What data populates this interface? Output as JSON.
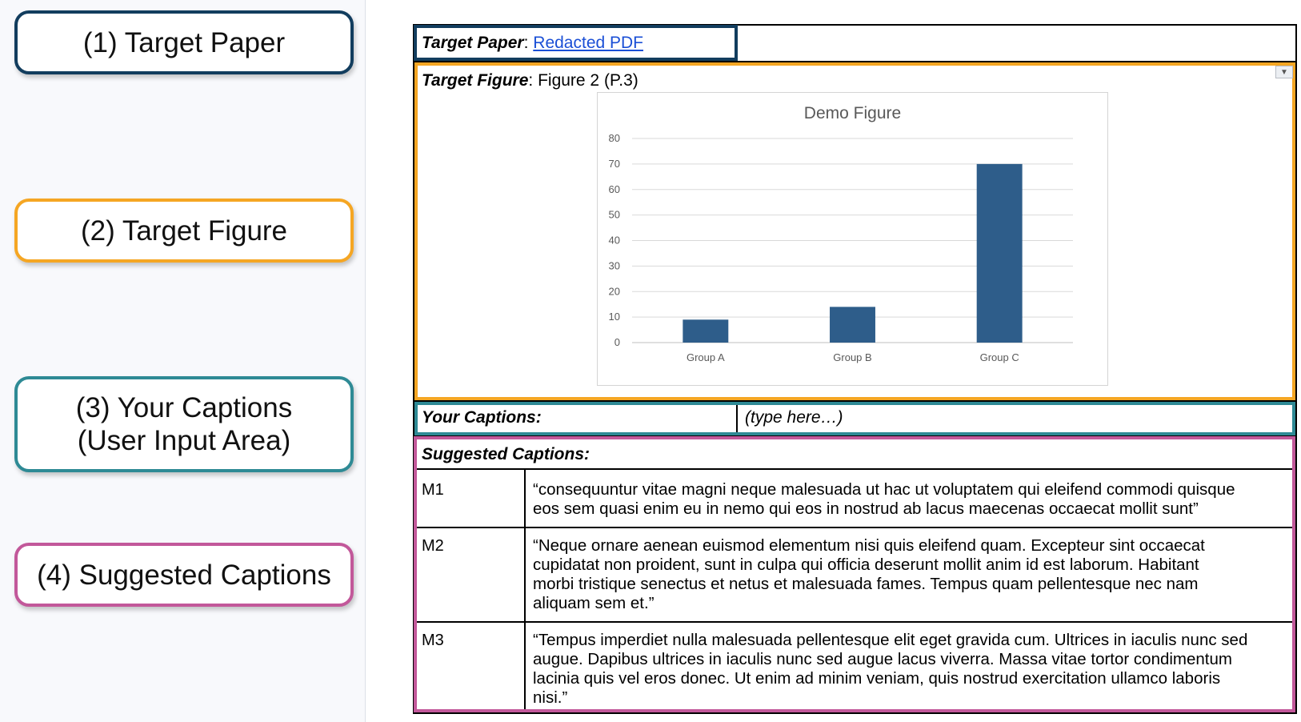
{
  "legend": {
    "items": [
      {
        "lines": [
          "(1) Target Paper"
        ],
        "color": "#123d5e"
      },
      {
        "lines": [
          "(2) Target Figure"
        ],
        "color": "#f5a623"
      },
      {
        "lines": [
          "(3) Your Captions",
          "(User Input Area)"
        ],
        "color": "#2e8a95"
      },
      {
        "lines": [
          "(4) Suggested Captions"
        ],
        "color": "#c2589a"
      }
    ]
  },
  "paper": {
    "label": "Target Paper",
    "separator": ": ",
    "link_text": "Redacted PDF"
  },
  "figure": {
    "label": "Target Figure",
    "value": ": Figure 2 (P.3)"
  },
  "chart_data": {
    "type": "bar",
    "title": "Demo Figure",
    "categories": [
      "Group A",
      "Group B",
      "Group C"
    ],
    "values": [
      9,
      14,
      70
    ],
    "ylim": [
      0,
      80
    ],
    "yticks": [
      0,
      10,
      20,
      30,
      40,
      50,
      60,
      70,
      80
    ],
    "grid": true,
    "bar_color": "#2e5d8a",
    "xlabel": "",
    "ylabel": ""
  },
  "captions": {
    "label": "Your Captions:",
    "placeholder": "(type here…)"
  },
  "suggested": {
    "label": "Suggested Captions:",
    "rows": [
      {
        "id": "M1",
        "lines": [
          "“consequuntur vitae magni neque malesuada ut hac ut voluptatem qui eleifend commodi quisque",
          "eos sem quasi enim eu in nemo qui eos in nostrud ab lacus maecenas occaecat mollit sunt”"
        ]
      },
      {
        "id": "M2",
        "lines": [
          "“Neque ornare aenean euismod elementum nisi quis eleifend quam. Excepteur sint occaecat",
          "cupidatat non proident, sunt in culpa qui officia deserunt mollit anim id est laborum. Habitant",
          "morbi tristique senectus et netus et malesuada fames. Tempus quam pellentesque nec nam",
          "aliquam sem et.”"
        ]
      },
      {
        "id": "M3",
        "lines": [
          "“Tempus imperdiet nulla malesuada pellentesque elit eget gravida cum. Ultrices in iaculis nunc sed",
          "augue. Dapibus ultrices in iaculis nunc sed augue lacus viverra. Massa vitae tortor condimentum",
          "lacinia quis vel eros donec. Ut enim ad minim veniam, quis nostrud exercitation ullamco laboris",
          "nisi.”"
        ]
      }
    ]
  }
}
